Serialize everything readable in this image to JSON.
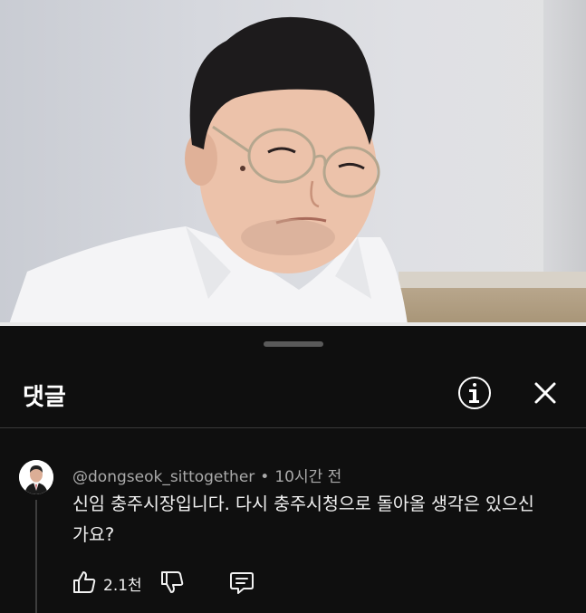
{
  "video": {
    "thumbnail_icon": "person-video-frame"
  },
  "comments_panel": {
    "title": "댓글",
    "info_icon": "info-icon",
    "close_icon": "close-icon"
  },
  "comment": {
    "author": "@dongseok_sittogether",
    "separator": "•",
    "time": "10시간 전",
    "text": "신임 충주시장입니다. 다시 충주시청으로 돌아올 생각은 있으신가요?",
    "likes": "2.1천",
    "like_icon": "thumbs-up-icon",
    "dislike_icon": "thumbs-down-icon",
    "reply_icon": "reply-comment-icon"
  }
}
